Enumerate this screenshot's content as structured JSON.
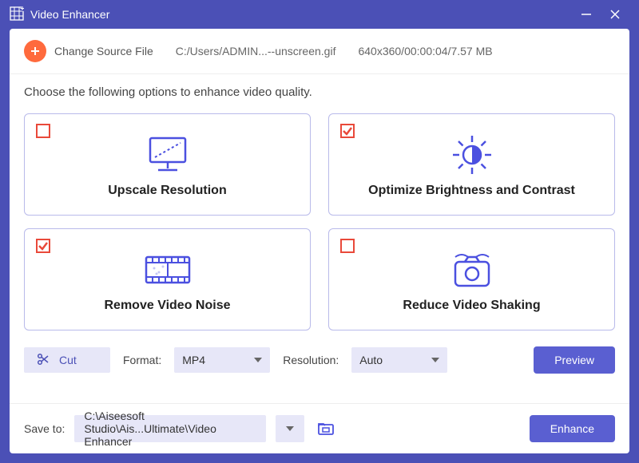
{
  "titlebar": {
    "title": "Video Enhancer"
  },
  "top": {
    "change_label": "Change Source File",
    "file_path": "C:/Users/ADMIN...--unscreen.gif",
    "file_info": "640x360/00:00:04/7.57 MB"
  },
  "instruction": "Choose the following options to enhance video quality.",
  "cards": {
    "upscale": {
      "label": "Upscale Resolution"
    },
    "brightness": {
      "label": "Optimize Brightness and Contrast"
    },
    "noise": {
      "label": "Remove Video Noise"
    },
    "shaking": {
      "label": "Reduce Video Shaking"
    }
  },
  "controls": {
    "cut_label": "Cut",
    "format_label": "Format:",
    "format_value": "MP4",
    "resolution_label": "Resolution:",
    "resolution_value": "Auto",
    "preview_label": "Preview"
  },
  "bottom": {
    "save_label": "Save to:",
    "save_path": "C:\\Aiseesoft Studio\\Ais...Ultimate\\Video Enhancer",
    "enhance_label": "Enhance"
  }
}
